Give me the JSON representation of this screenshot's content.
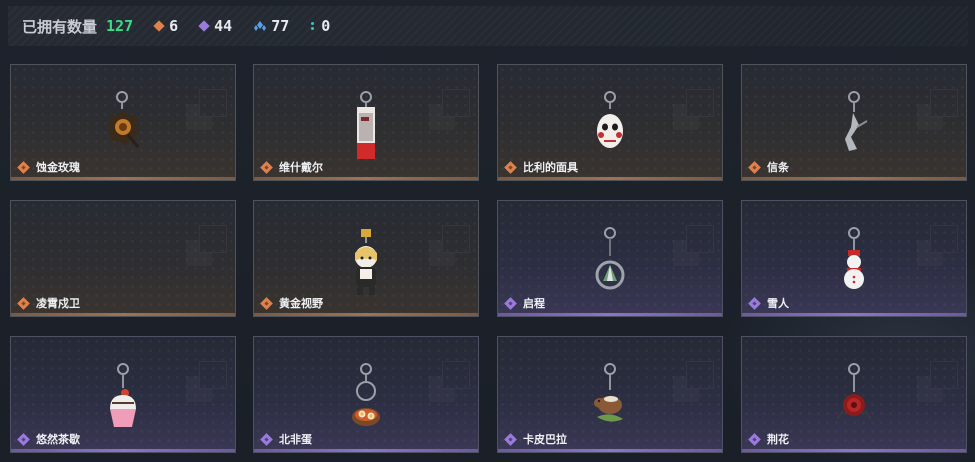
{
  "header": {
    "owned_label": "已拥有数量",
    "owned_total": "127",
    "stats": [
      {
        "icon": "bronze-gem-icon",
        "color": "#e0804a",
        "value": "6"
      },
      {
        "icon": "purple-gem-icon",
        "color": "#9b7ae0",
        "value": "44"
      },
      {
        "icon": "blue-gem-icon",
        "color": "#5aa0e8",
        "value": "77"
      },
      {
        "icon": "teal-dots-icon",
        "color": "#2fc7c7",
        "value": "0"
      }
    ]
  },
  "items": [
    {
      "name": "蚀金玫瑰",
      "rarity": "bronze"
    },
    {
      "name": "维什戴尔",
      "rarity": "bronze"
    },
    {
      "name": "比利的面具",
      "rarity": "bronze"
    },
    {
      "name": "信条",
      "rarity": "bronze"
    },
    {
      "name": "凌霄戍卫",
      "rarity": "bronze"
    },
    {
      "name": "黄金视野",
      "rarity": "bronze"
    },
    {
      "name": "启程",
      "rarity": "purple"
    },
    {
      "name": "雪人",
      "rarity": "purple"
    },
    {
      "name": "悠然茶歇",
      "rarity": "purple"
    },
    {
      "name": "北非蛋",
      "rarity": "purple"
    },
    {
      "name": "卡皮巴拉",
      "rarity": "purple"
    },
    {
      "name": "荆花",
      "rarity": "purple"
    }
  ],
  "colors": {
    "bronze": "#e0804a",
    "purple": "#9b7ae0",
    "total_green": "#3ddc84"
  }
}
